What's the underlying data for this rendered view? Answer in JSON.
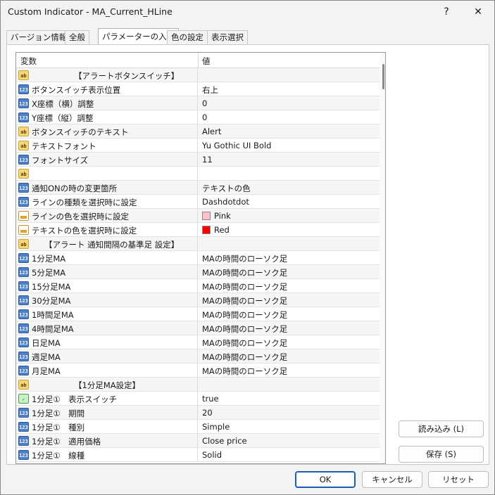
{
  "window": {
    "title": "Custom Indicator - MA_Current_HLine",
    "help_label": "?",
    "close_label": "✕"
  },
  "tabs": [
    {
      "label": "バージョン情報"
    },
    {
      "label": "全般"
    },
    {
      "label": "パラメーターの入力"
    },
    {
      "label": "色の設定"
    },
    {
      "label": "表示選択"
    }
  ],
  "grid": {
    "col_name": "変数",
    "col_value": "値",
    "rows": [
      {
        "icon": "ab",
        "name": "【アラートボタンスイッチ】",
        "value": "",
        "centered": true
      },
      {
        "icon": "123",
        "name": "ボタンスイッチ表示位置",
        "value": "右上"
      },
      {
        "icon": "123",
        "name": "X座標（横）調整",
        "value": "0"
      },
      {
        "icon": "123",
        "name": "Y座標（縦）調整",
        "value": "0"
      },
      {
        "icon": "ab",
        "name": "ボタンスイッチのテキスト",
        "value": "Alert"
      },
      {
        "icon": "ab",
        "name": "テキストフォント",
        "value": "Yu Gothic UI Bold"
      },
      {
        "icon": "123",
        "name": "フォントサイズ",
        "value": "11"
      },
      {
        "icon": "ab",
        "name": "",
        "value": ""
      },
      {
        "icon": "123",
        "name": "通知ONの時の変更箇所",
        "value": "テキストの色"
      },
      {
        "icon": "123",
        "name": "ラインの種類を選択時に設定",
        "value": "Dashdotdot"
      },
      {
        "icon": "color",
        "name": "ラインの色を選択時に設定",
        "value": "Pink",
        "swatch": "#FFC0CB"
      },
      {
        "icon": "color",
        "name": "テキストの色を選択時に設定",
        "value": "Red",
        "swatch": "#FF0000"
      },
      {
        "icon": "ab",
        "name": "【アラート 通知間隔の基準足 設定】",
        "value": "",
        "centered": true,
        "indent": 40
      },
      {
        "icon": "123",
        "name": "1分足MA",
        "value": "MAの時間のローソク足"
      },
      {
        "icon": "123",
        "name": "5分足MA",
        "value": "MAの時間のローソク足"
      },
      {
        "icon": "123",
        "name": "15分足MA",
        "value": "MAの時間のローソク足"
      },
      {
        "icon": "123",
        "name": "30分足MA",
        "value": "MAの時間のローソク足"
      },
      {
        "icon": "123",
        "name": "1時間足MA",
        "value": "MAの時間のローソク足"
      },
      {
        "icon": "123",
        "name": "4時間足MA",
        "value": "MAの時間のローソク足"
      },
      {
        "icon": "123",
        "name": "日足MA",
        "value": "MAの時間のローソク足"
      },
      {
        "icon": "123",
        "name": "週足MA",
        "value": "MAの時間のローソク足"
      },
      {
        "icon": "123",
        "name": "月足MA",
        "value": "MAの時間のローソク足"
      },
      {
        "icon": "ab",
        "name": "【1分足MA設定】",
        "value": "",
        "centered": true
      },
      {
        "icon": "bool",
        "name": "1分足①　表示スイッチ",
        "value": "true"
      },
      {
        "icon": "123",
        "name": "1分足①　期間",
        "value": "20"
      },
      {
        "icon": "123",
        "name": "1分足①　種別",
        "value": "Simple"
      },
      {
        "icon": "123",
        "name": "1分足①　適用価格",
        "value": "Close price"
      },
      {
        "icon": "123",
        "name": "1分足①　線種",
        "value": "Solid"
      }
    ]
  },
  "side_buttons": {
    "load_label": "読み込み (L)",
    "save_label": "保存 (S)"
  },
  "footer": {
    "ok_label": "OK",
    "cancel_label": "キャンセル",
    "reset_label": "リセット"
  }
}
